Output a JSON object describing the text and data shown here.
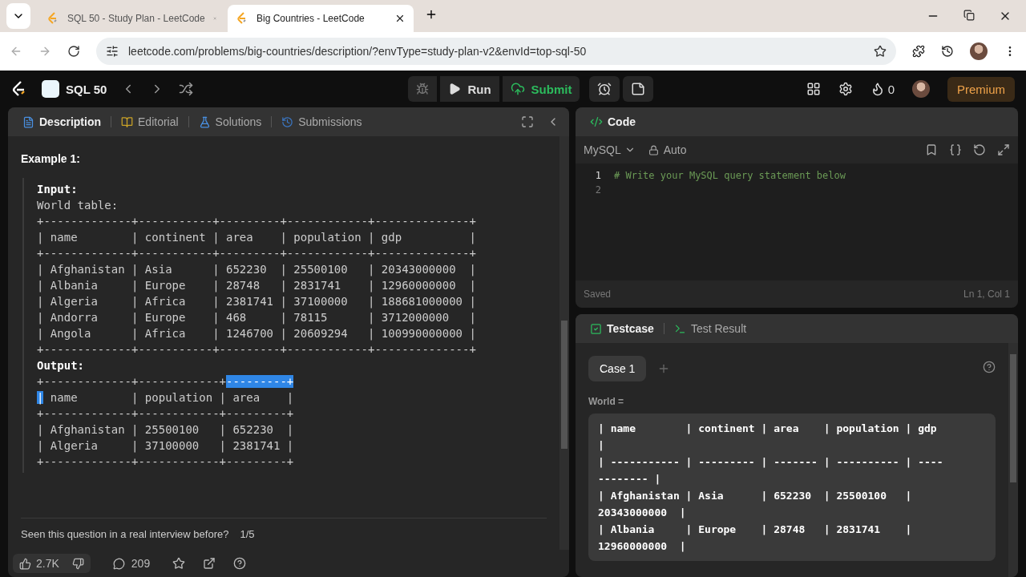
{
  "browser": {
    "tabs": [
      {
        "title": "SQL 50 - Study Plan - LeetCode",
        "selected": false
      },
      {
        "title": "Big Countries - LeetCode",
        "selected": true
      }
    ],
    "url": "leetcode.com/problems/big-countries/description/?envType=study-plan-v2&envId=top-sql-50"
  },
  "topbar": {
    "problem_set": "SQL 50",
    "run": "Run",
    "submit": "Submit",
    "streak": "0",
    "premium": "Premium"
  },
  "description": {
    "tabs": [
      {
        "label": "Description",
        "selected": true
      },
      {
        "label": "Editorial",
        "selected": false
      },
      {
        "label": "Solutions",
        "selected": false
      },
      {
        "label": "Submissions",
        "selected": false
      }
    ],
    "example_title": "Example 1:",
    "input_label": "Input:",
    "input_lines": [
      "World table:",
      "+-------------+-----------+---------+------------+--------------+",
      "| name        | continent | area    | population | gdp          |",
      "+-------------+-----------+---------+------------+--------------+",
      "| Afghanistan | Asia      | 652230  | 25500100   | 20343000000  |",
      "| Albania     | Europe    | 28748   | 2831741    | 12960000000  |",
      "| Algeria     | Africa    | 2381741 | 37100000   | 188681000000 |",
      "| Andorra     | Europe    | 468     | 78115      | 3712000000   |",
      "| Angola      | Africa    | 1246700 | 20609294   | 100990000000 |",
      "+-------------+-----------+---------+------------+--------------+"
    ],
    "output_label": "Output:",
    "output_lines": [
      [
        {
          "text": "+-------------+------------+",
          "selected": false
        },
        {
          "text": "---------+",
          "selected": true
        }
      ],
      [
        {
          "text": "|",
          "selected": true
        },
        {
          "text": " name        | population | area    |",
          "selected": false
        }
      ],
      [
        {
          "text": "+-------------+------------+---------+",
          "selected": false
        }
      ],
      [
        {
          "text": "| Afghanistan | 25500100   | 652230  |",
          "selected": false
        }
      ],
      [
        {
          "text": "| Algeria     | 37100000   | 2381741 |",
          "selected": false
        }
      ],
      [
        {
          "text": "+-------------+------------+---------+",
          "selected": false
        }
      ]
    ],
    "interview_question": "Seen this question in a real interview before?",
    "interview_count": "1/5",
    "likes": "2.7K",
    "comments": "209"
  },
  "code": {
    "title": "Code",
    "language": "MySQL",
    "mode": "Auto",
    "lines": [
      {
        "number": "1",
        "text": "# Write your MySQL query statement below"
      },
      {
        "number": "2"
      }
    ],
    "status": "Saved",
    "cursor": "Ln 1, Col 1"
  },
  "testcase": {
    "tabs": [
      {
        "label": "Testcase",
        "selected": true
      },
      {
        "label": "Test Result",
        "selected": false
      }
    ],
    "cases": [
      {
        "label": "Case 1",
        "selected": true
      }
    ],
    "param_label": "World =",
    "value_lines": [
      "| name        | continent | area    | population | gdp",
      "|",
      "| ----------- | --------- | ------- | ---------- | ----",
      "-------- |",
      "| Afghanistan | Asia      | 652230  | 25500100   |",
      "20343000000  |",
      "| Albania     | Europe    | 28748   | 2831741    |",
      "12960000000  |"
    ]
  }
}
